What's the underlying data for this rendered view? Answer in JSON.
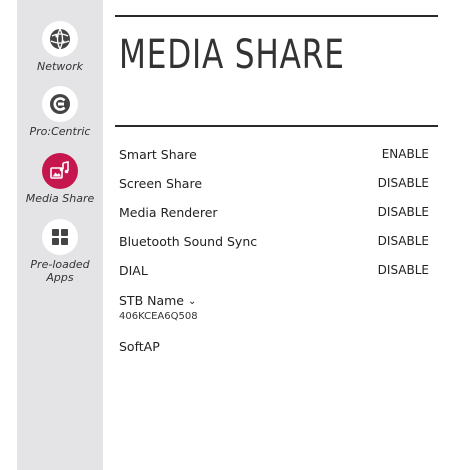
{
  "sidebar": {
    "items": [
      {
        "label": "Network",
        "icon": "globe-icon"
      },
      {
        "label": "Pro:Centric",
        "icon": "procentric-icon"
      },
      {
        "label": "Media Share",
        "icon": "media-share-icon"
      },
      {
        "label": "Pre-loaded Apps",
        "icon": "apps-grid-icon"
      }
    ],
    "active_color": "#c5174e"
  },
  "main": {
    "title": "MEDIA SHARE",
    "settings": [
      {
        "label": "Smart Share",
        "value": "ENABLE"
      },
      {
        "label": "Screen Share",
        "value": "DISABLE"
      },
      {
        "label": "Media Renderer",
        "value": "DISABLE"
      },
      {
        "label": "Bluetooth Sound Sync",
        "value": "DISABLE"
      },
      {
        "label": "DIAL",
        "value": "DISABLE"
      }
    ],
    "stb_name": {
      "label": "STB Name",
      "value": "406KCEA6Q508"
    },
    "softap": {
      "label": "SoftAP"
    }
  }
}
